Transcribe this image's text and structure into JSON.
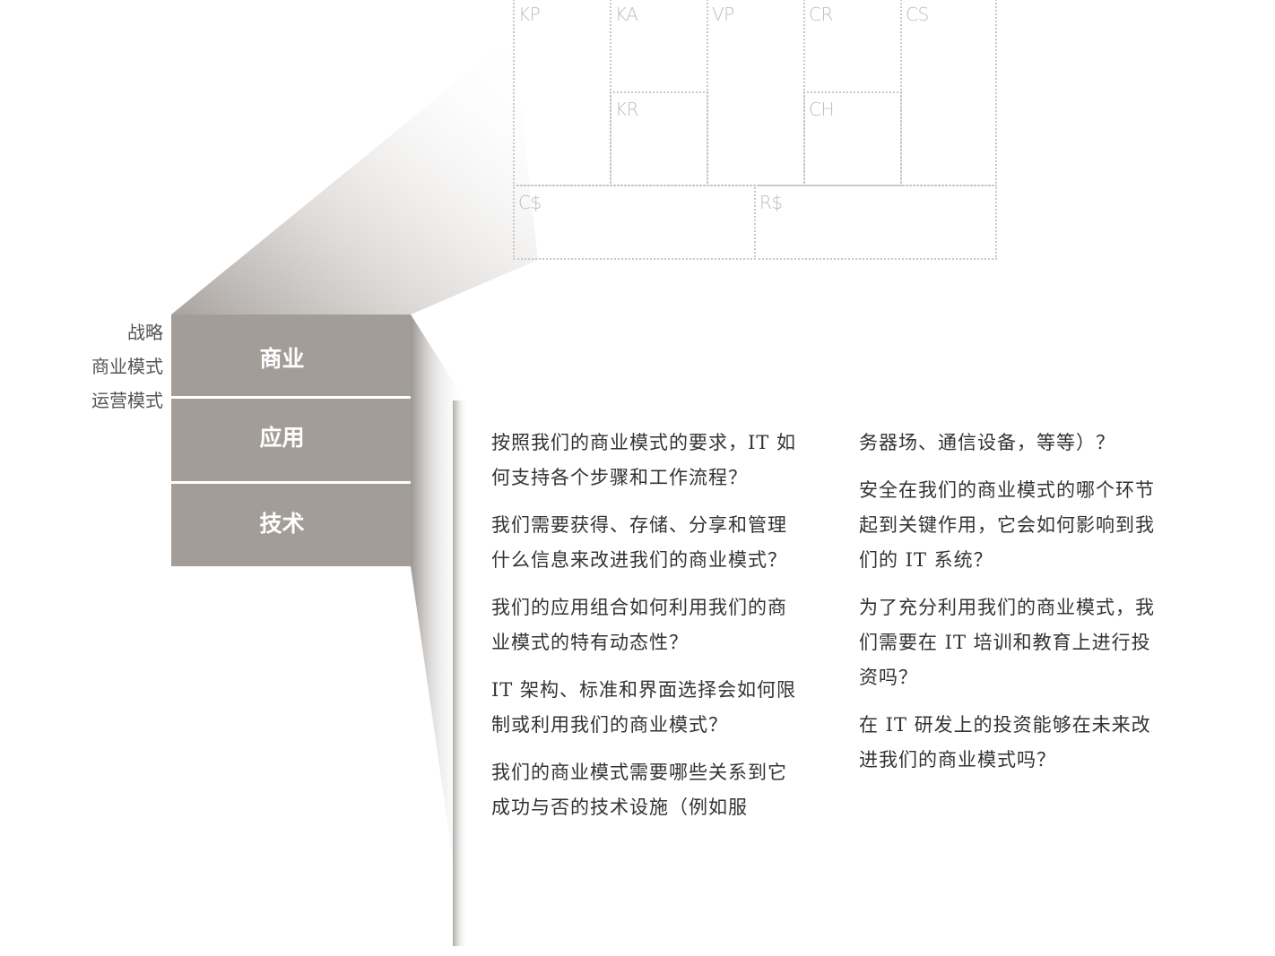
{
  "canvas": {
    "cells": {
      "kp": "KP",
      "ka": "KA",
      "vp": "VP",
      "cr": "CR",
      "cs": "CS",
      "kr": "KR",
      "ch": "CH",
      "cost": "C$",
      "revenue": "R$"
    }
  },
  "side_labels": {
    "strategy": "战略",
    "business_model": "商业模式",
    "operating_model": "运营模式"
  },
  "layers": {
    "business": "商业",
    "application": "应用",
    "technology": "技术"
  },
  "questions": {
    "left": [
      "按照我们的商业模式的要求，IT 如何支持各个步骤和工作流程？",
      "我们需要获得、存储、分享和管理什么信息来改进我们的商业模式？",
      "我们的应用组合如何利用我们的商业模式的特有动态性？",
      "IT 架构、标准和界面选择会如何限制或利用我们的商业模式？",
      "我们的商业模式需要哪些关系到它成功与否的技术设施（例如服"
    ],
    "right": [
      "务器场、通信设备，等等）？",
      "安全在我们的商业模式的哪个环节起到关键作用，它会如何影响到我们的 IT 系统？",
      "为了充分利用我们的商业模式，我们需要在 IT 培训和教育上进行投资吗？",
      "在 IT 研发上的投资能够在未来改进我们的商业模式吗？"
    ]
  },
  "colors": {
    "layer_fill": "#a39d98",
    "layer_text": "#ffffff",
    "grid_line": "#c9c9c9",
    "grid_label": "#bdbdbd",
    "body_text": "#333333"
  }
}
